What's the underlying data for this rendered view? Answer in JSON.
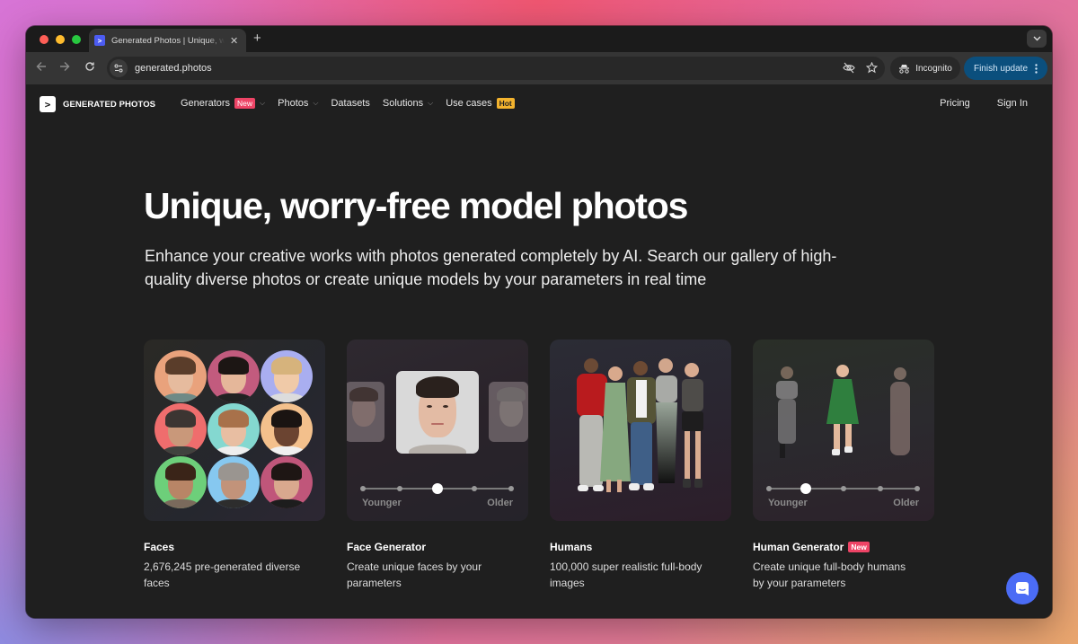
{
  "browser": {
    "tab": {
      "title": "Generated Photos | Unique, worry-free model photos",
      "favicon": ">"
    },
    "new_tab_icon": "+",
    "url": "generated.photos",
    "incognito_label": "Incognito",
    "finish_update_label": "Finish update"
  },
  "site": {
    "logo_text": "GENERATED PHOTOS",
    "nav": [
      {
        "label": "Generators",
        "badge": "New",
        "dropdown": true
      },
      {
        "label": "Photos",
        "dropdown": true
      },
      {
        "label": "Datasets"
      },
      {
        "label": "Solutions",
        "dropdown": true
      },
      {
        "label": "Use cases",
        "badge": "Hot"
      }
    ],
    "nav_right": {
      "pricing": "Pricing",
      "sign_in": "Sign In"
    }
  },
  "hero": {
    "title": "Unique, worry-free model photos",
    "subtitle": "Enhance your creative works with photos generated completely by AI. Search our gallery of high-quality diverse photos or create unique models by your parameters in real time"
  },
  "cards": [
    {
      "title": "Faces",
      "description": "2,676,245 pre-generated diverse faces"
    },
    {
      "title": "Face Generator",
      "description": "Create unique faces by your parameters",
      "slider": {
        "min_label": "Younger",
        "max_label": "Older",
        "steps": 5,
        "position": 0.5
      }
    },
    {
      "title": "Humans",
      "description": "100,000 super realistic full-body images"
    },
    {
      "title": "Human Generator",
      "badge": "New",
      "description": "Create unique full-body humans by your parameters",
      "slider": {
        "min_label": "Younger",
        "max_label": "Older",
        "steps": 5,
        "position": 0.25
      }
    }
  ],
  "face_colors": [
    "#e9a27c",
    "#c25b7e",
    "#a9aef0",
    "#ef6d6d",
    "#84d8d0",
    "#f3c08c",
    "#6dcf7a",
    "#86c8f0",
    "#c0567a"
  ],
  "colors": {
    "accent_new": "#ee4466",
    "accent_hot": "#f3b32e",
    "chat": "#4b6cf5",
    "update_btn": "#0b4f7d"
  }
}
